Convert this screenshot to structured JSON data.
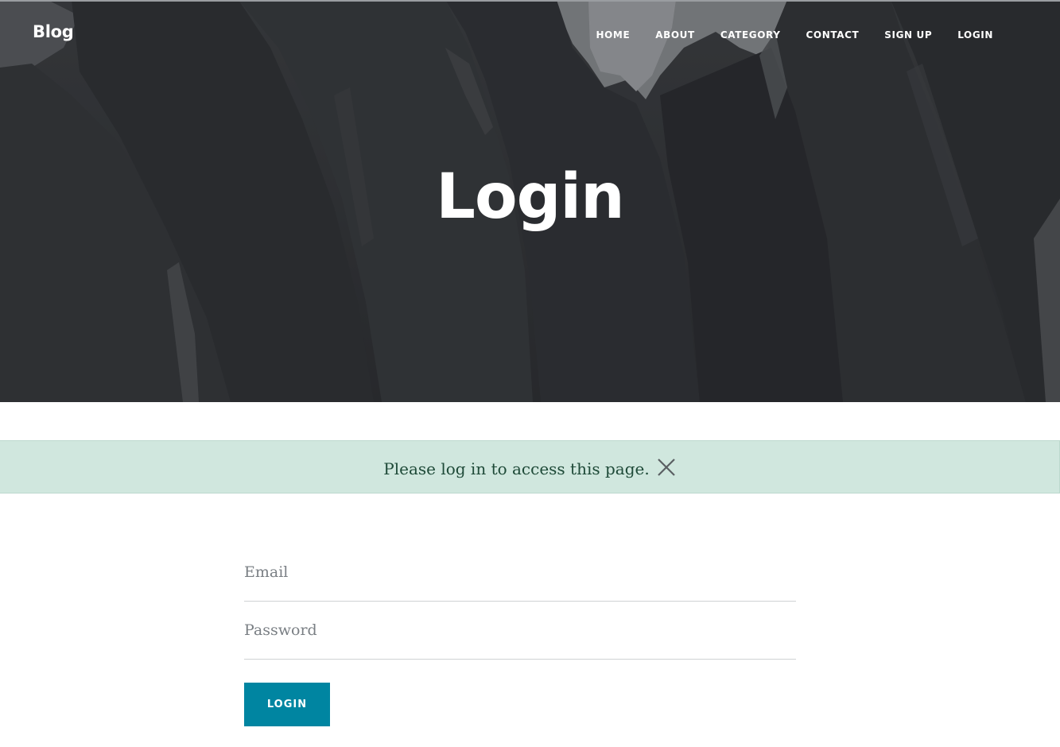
{
  "navbar": {
    "brand": "Blog",
    "links": [
      "HOME",
      "ABOUT",
      "CATEGORY",
      "CONTACT",
      "SIGN UP",
      "LOGIN"
    ]
  },
  "hero": {
    "heading": "Login"
  },
  "flash": {
    "message": "Please log in to access this page."
  },
  "form": {
    "email_placeholder": "Email",
    "email_value": "",
    "password_placeholder": "Password",
    "password_value": "",
    "submit_label": "LOGIN"
  },
  "colors": {
    "accent": "#0085a1",
    "flash_background": "#d0e7de",
    "flash_text": "#1e4a38"
  },
  "icons": {
    "flash_close": "close-icon"
  }
}
